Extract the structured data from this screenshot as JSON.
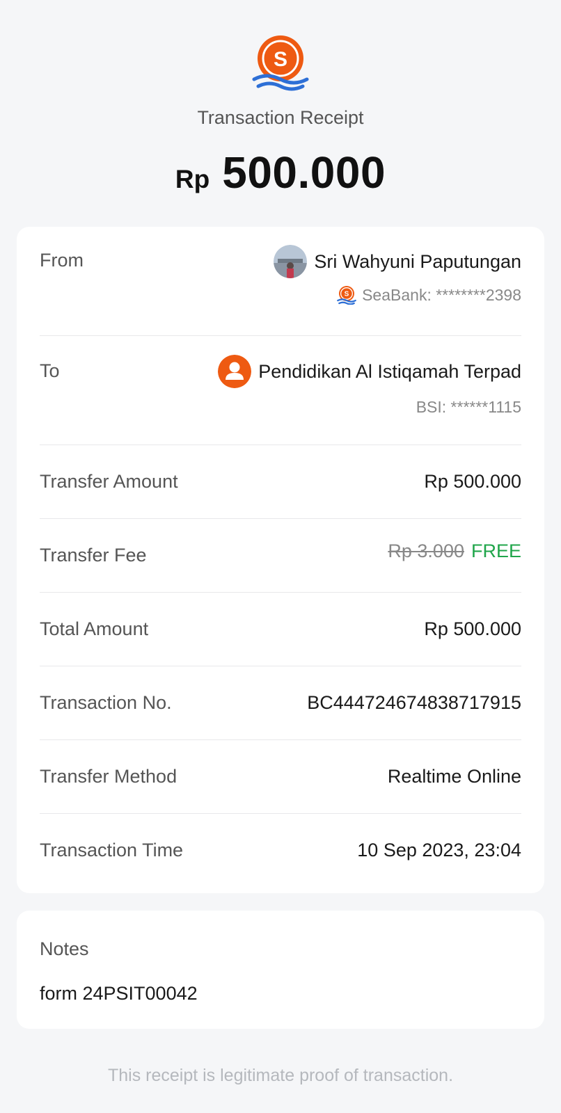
{
  "header": {
    "logo_icon": "seabank-logo-icon",
    "title": "Transaction Receipt",
    "currency": "Rp",
    "amount": "500.000"
  },
  "from": {
    "label": "From",
    "name": "Sri Wahyuni Paputungan",
    "account": "SeaBank: ********2398"
  },
  "to": {
    "label": "To",
    "name": "Pendidikan Al Istiqamah Terpad",
    "account": "BSI: ******1115"
  },
  "details": {
    "transfer_amount_label": "Transfer Amount",
    "transfer_amount": "Rp 500.000",
    "transfer_fee_label": "Transfer Fee",
    "transfer_fee_original": "Rp 3.000",
    "transfer_fee_status": "FREE",
    "total_amount_label": "Total Amount",
    "total_amount": "Rp 500.000",
    "transaction_no_label": "Transaction No.",
    "transaction_no": "BC444724674838717915",
    "transfer_method_label": "Transfer Method",
    "transfer_method": "Realtime Online",
    "transaction_time_label": "Transaction Time",
    "transaction_time": "10 Sep 2023, 23:04"
  },
  "notes": {
    "label": "Notes",
    "value": "form 24PSIT00042"
  },
  "footer": {
    "text": "This receipt is legitimate proof of transaction."
  },
  "colors": {
    "brand_orange": "#ee5a12",
    "brand_blue": "#2d6fd6",
    "free_green": "#1fa54a",
    "background": "#f5f6f8"
  }
}
